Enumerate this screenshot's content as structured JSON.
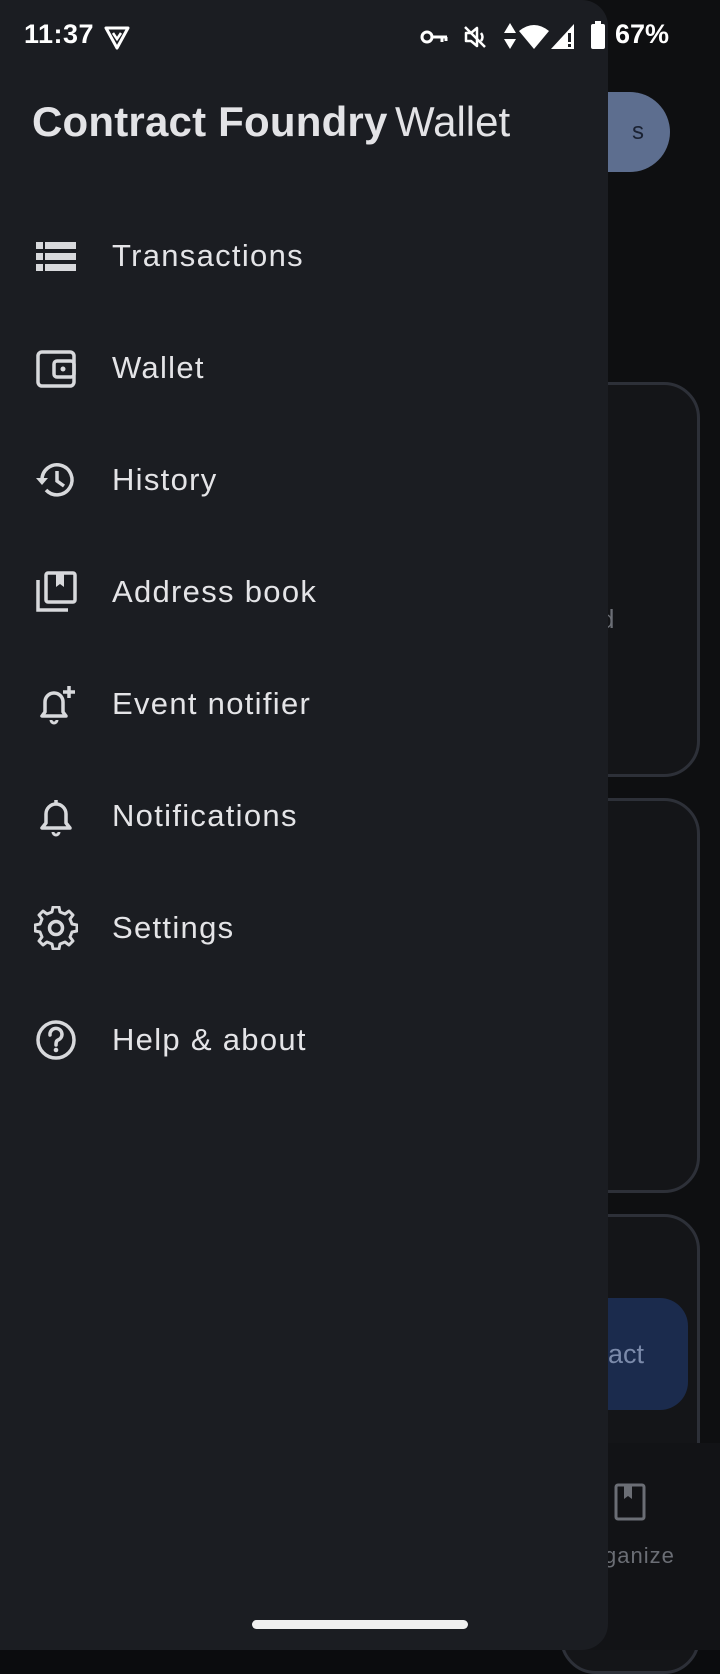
{
  "status_bar": {
    "time": "11:37",
    "battery_percent": "67%",
    "icons": [
      "vpn-shield-icon",
      "key-icon",
      "mute-icon",
      "data-arrows-icon",
      "wifi-icon",
      "signal-icon",
      "battery-icon"
    ]
  },
  "drawer": {
    "title": "Contract Foundry",
    "subtitle": "Wallet",
    "items": [
      {
        "label": "Transactions",
        "icon": "transactions-icon"
      },
      {
        "label": "Wallet",
        "icon": "wallet-icon"
      },
      {
        "label": "History",
        "icon": "history-icon"
      },
      {
        "label": "Address book",
        "icon": "address-book-icon"
      },
      {
        "label": "Event notifier",
        "icon": "event-notifier-icon"
      },
      {
        "label": "Notifications",
        "icon": "bell-icon"
      },
      {
        "label": "Settings",
        "icon": "gear-icon"
      },
      {
        "label": "Help & about",
        "icon": "help-icon"
      }
    ]
  },
  "background": {
    "pill_text": "s",
    "card_text": "d",
    "action_text": "act",
    "nav_label": "ganize"
  },
  "colors": {
    "drawer_bg": "#1b1d22",
    "text_primary": "#e4e4e7",
    "accent_pill": "#5d6e8f",
    "action_button": "#1b2b4d"
  }
}
